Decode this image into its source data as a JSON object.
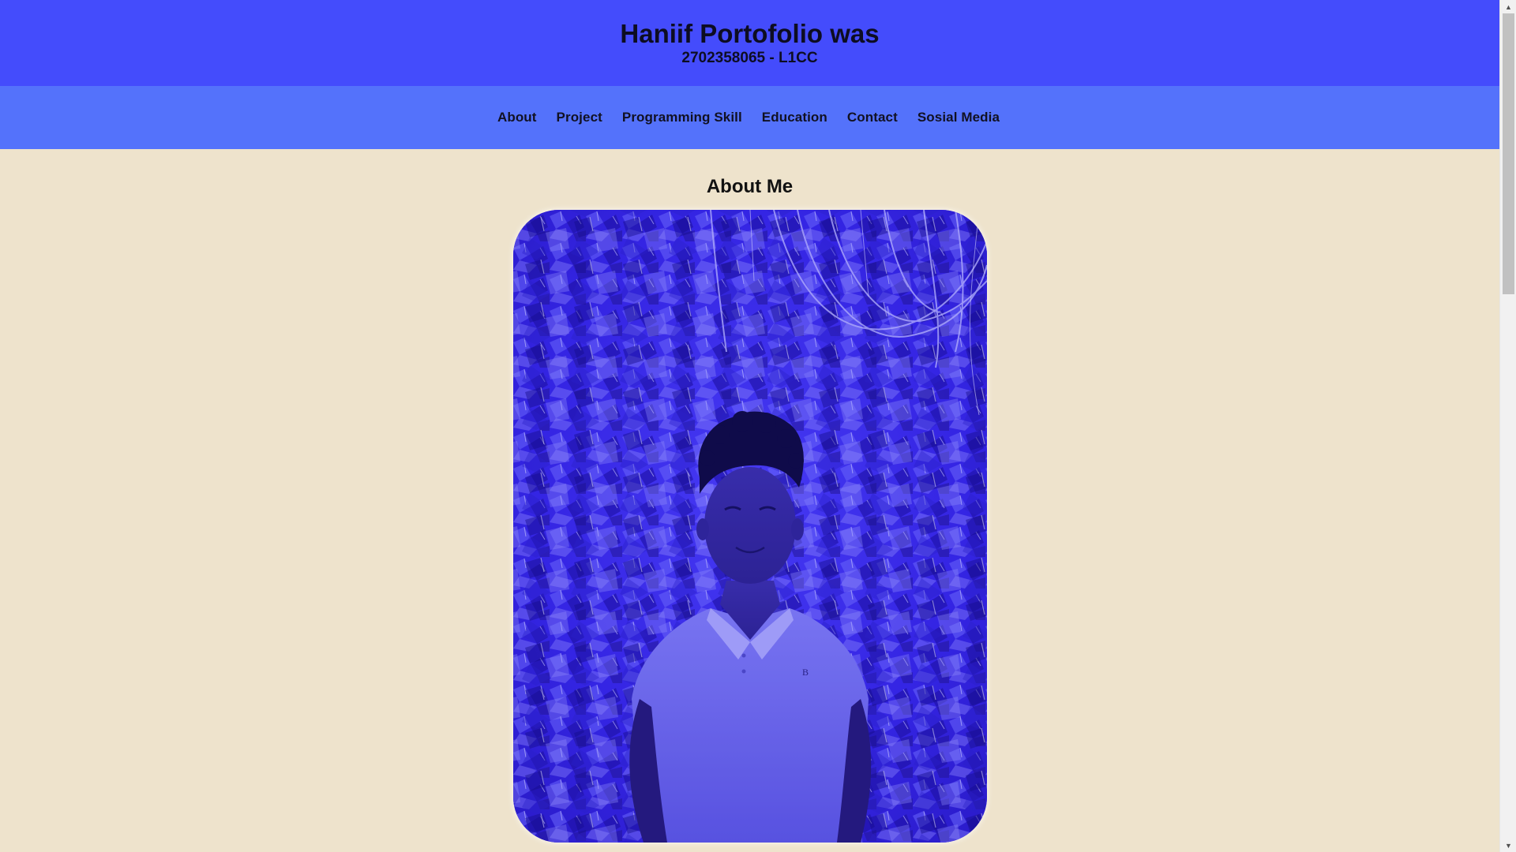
{
  "header": {
    "title": "Haniif Portofolio was",
    "subtitle": "2702358065 - L1CC"
  },
  "nav": {
    "items": [
      {
        "label": "About"
      },
      {
        "label": "Project"
      },
      {
        "label": "Programming Skill"
      },
      {
        "label": "Education"
      },
      {
        "label": "Contact"
      },
      {
        "label": "Sosial Media"
      }
    ]
  },
  "about": {
    "heading": "About Me",
    "photo_icon": "profile-photo"
  },
  "scrollbar": {
    "up_icon": "triangle-up",
    "down_icon": "triangle-down"
  },
  "colors": {
    "header_bg": "#444cfc",
    "nav_bg": "#5472fb",
    "page_bg": "#eee3cc",
    "photo_bg": "#3b2cf0"
  }
}
